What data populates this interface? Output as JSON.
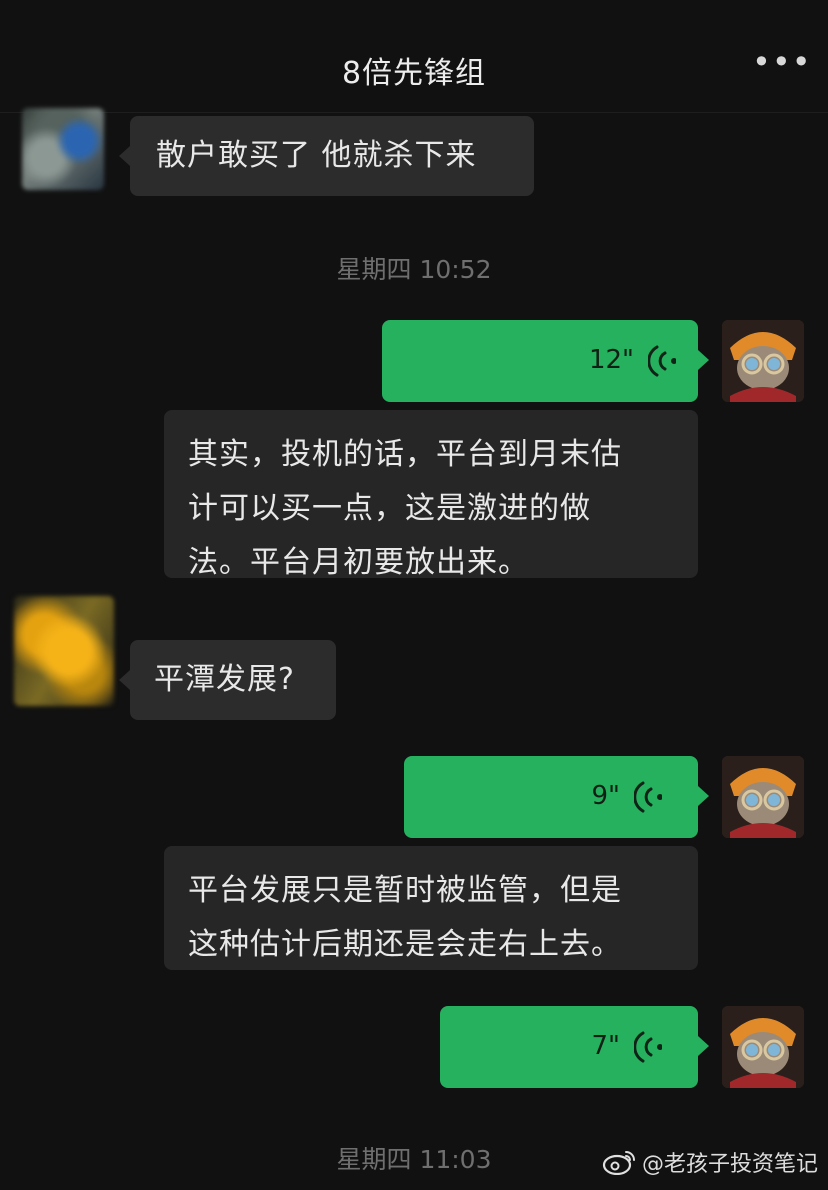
{
  "header": {
    "title": "8倍先锋组",
    "more_label": "•••"
  },
  "messages": {
    "m1": {
      "text": "散户敢买了 他就杀下来"
    },
    "ts1": "星期四 10:52",
    "v1": {
      "duration": "12\""
    },
    "t1": {
      "lines": [
        "其实，投机的话，平台到月末估",
        "计可以买一点，这是激进的做",
        "法。平台月初要放出来。"
      ]
    },
    "m2": {
      "text": "平潭发展?"
    },
    "v2": {
      "duration": "9\""
    },
    "t2": {
      "lines": [
        "平台发展只是暂时被监管，但是",
        "这种估计后期还是会走右上去。"
      ]
    },
    "v3": {
      "duration": "7\""
    },
    "ts2": "星期四 11:03"
  },
  "watermark": {
    "text": "@老孩子投资笔记",
    "icon": "weibo-icon"
  },
  "colors": {
    "background": "#111111",
    "voice_bubble": "#25b15e",
    "left_bubble": "#2c2c2c",
    "timestamp": "#6f6f6f"
  }
}
